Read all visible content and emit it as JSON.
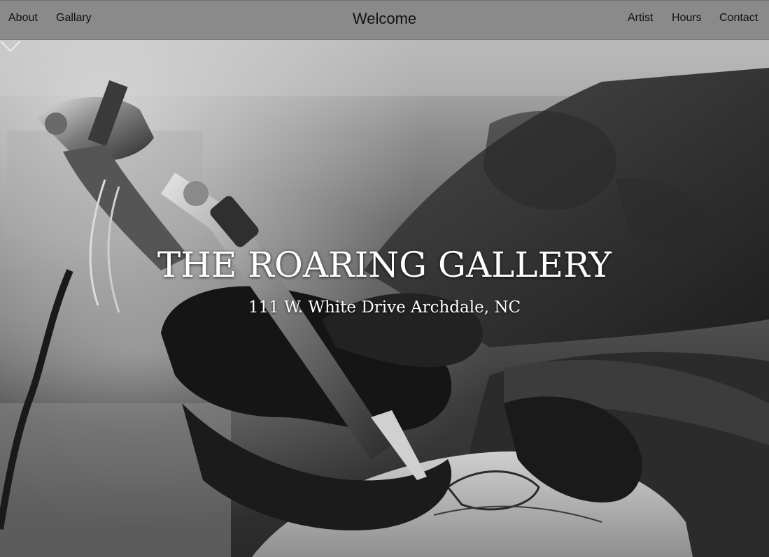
{
  "nav": {
    "left_links": [
      "About",
      "Gallary"
    ],
    "center_title": "Welcome",
    "right_links": [
      "Artist",
      "Hours",
      "Contact"
    ]
  },
  "hero": {
    "title": "THE ROARING GALLERY",
    "address": "111 W. White Drive Archdale, NC",
    "scroll_icon": "chevron-down-icon",
    "background_image": "grayscale photo of a gloved hand using a tattoo machine on skin"
  },
  "colors": {
    "nav_background": "#8a8a8a",
    "nav_text": "#111111",
    "hero_text": "#ffffff"
  }
}
